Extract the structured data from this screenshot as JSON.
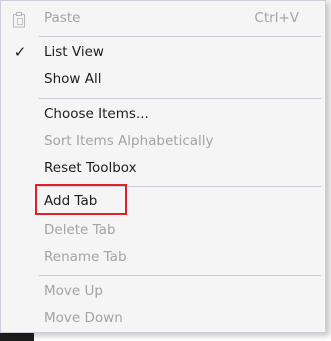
{
  "menu": {
    "paste": {
      "label": "Paste",
      "shortcut": "Ctrl+V",
      "icon": "clipboard-icon"
    },
    "list_view": {
      "label": "List View",
      "checked_icon": "check-icon",
      "check_glyph": "✓"
    },
    "show_all": {
      "label": "Show All"
    },
    "choose_items": {
      "label": "Choose Items..."
    },
    "sort_items": {
      "label": "Sort Items Alphabetically"
    },
    "reset_toolbox": {
      "label": "Reset Toolbox"
    },
    "add_tab": {
      "label": "Add Tab"
    },
    "delete_tab": {
      "label": "Delete Tab"
    },
    "rename_tab": {
      "label": "Rename Tab"
    },
    "move_up": {
      "label": "Move Up"
    },
    "move_down": {
      "label": "Move Down"
    }
  },
  "colors": {
    "enabled_text": "#1e1e1e",
    "disabled_text": "#a2a4a5",
    "separator": "#cccedb",
    "highlight_box": "#e0202a"
  }
}
